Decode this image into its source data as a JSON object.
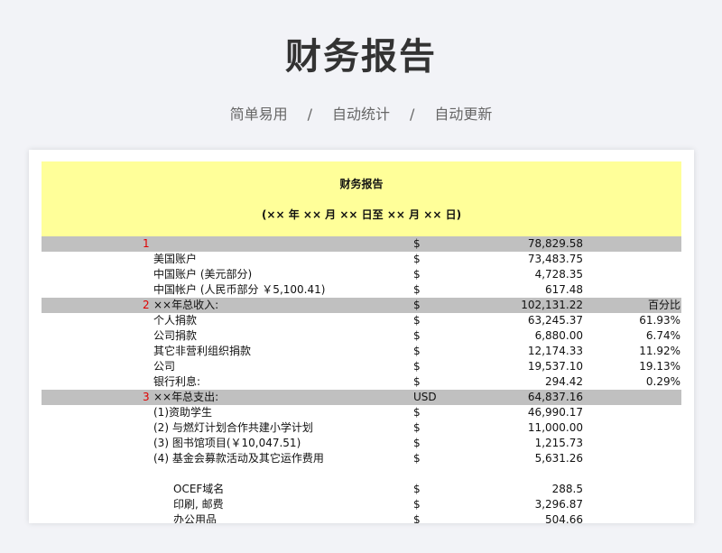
{
  "hero": {
    "title": "财务报告",
    "tags": [
      "简单易用",
      "自动统计",
      "自动更新"
    ],
    "separator": "/"
  },
  "sheet": {
    "title": "财务报告",
    "date_range": "(×× 年 ×× 月 ×× 日至 ×× 月 ×× 日)",
    "rows": [
      {
        "num": "1",
        "label": "",
        "currency": "$",
        "amount": "78,829.58",
        "pct": "",
        "style": "gray"
      },
      {
        "num": "",
        "label": "美国账户",
        "currency": "$",
        "amount": "73,483.75",
        "pct": "",
        "style": "sub"
      },
      {
        "num": "",
        "label": "中国账户 (美元部分)",
        "currency": "$",
        "amount": "4,728.35",
        "pct": "",
        "style": "sub"
      },
      {
        "num": "",
        "label": "中国帐户 (人民币部分 ￥5,100.41)",
        "currency": "$",
        "amount": "617.48",
        "pct": "",
        "style": "sub"
      },
      {
        "num": "2",
        "label": "××年总收入:",
        "currency": "$",
        "amount": "102,131.22",
        "pct": "百分比",
        "style": "gray"
      },
      {
        "num": "",
        "label": "个人捐款",
        "currency": "$",
        "amount": "63,245.37",
        "pct": "61.93%",
        "style": "sub"
      },
      {
        "num": "",
        "label": "公司捐款",
        "currency": "$",
        "amount": "6,880.00",
        "pct": "6.74%",
        "style": "sub"
      },
      {
        "num": "",
        "label": "其它非营利组织捐款",
        "currency": "$",
        "amount": "12,174.33",
        "pct": "11.92%",
        "style": "sub"
      },
      {
        "num": "",
        "label": "公司",
        "currency": "$",
        "amount": "19,537.10",
        "pct": "19.13%",
        "style": "sub"
      },
      {
        "num": "",
        "label": "银行利息:",
        "currency": "$",
        "amount": "294.42",
        "pct": "0.29%",
        "style": "sub"
      },
      {
        "num": "3",
        "label": "××年总支出:",
        "currency": "USD",
        "amount": "64,837.16",
        "pct": "",
        "style": "gray"
      },
      {
        "num": "",
        "label": "(1)资助学生",
        "currency": "$",
        "amount": "46,990.17",
        "pct": "",
        "style": "sub"
      },
      {
        "num": "",
        "label": "(2) 与燃灯计划合作共建小学计划",
        "currency": "$",
        "amount": "11,000.00",
        "pct": "",
        "style": "sub"
      },
      {
        "num": "",
        "label": "(3) 图书馆项目(￥10,047.51)",
        "currency": "$",
        "amount": "1,215.73",
        "pct": "",
        "style": "sub"
      },
      {
        "num": "",
        "label": "(4) 基金会募款活动及其它运作费用",
        "currency": "$",
        "amount": "5,631.26",
        "pct": "",
        "style": "sub"
      },
      {
        "num": "",
        "label": "",
        "currency": "",
        "amount": "",
        "pct": "",
        "style": "spacer"
      },
      {
        "num": "",
        "label": "OCEF域名",
        "currency": "$",
        "amount": "288.5",
        "pct": "",
        "style": "sub2"
      },
      {
        "num": "",
        "label": "印刷, 邮费",
        "currency": "$",
        "amount": "3,296.87",
        "pct": "",
        "style": "sub2"
      },
      {
        "num": "",
        "label": "办公用品",
        "currency": "$",
        "amount": "504.66",
        "pct": "",
        "style": "sub2"
      }
    ]
  }
}
